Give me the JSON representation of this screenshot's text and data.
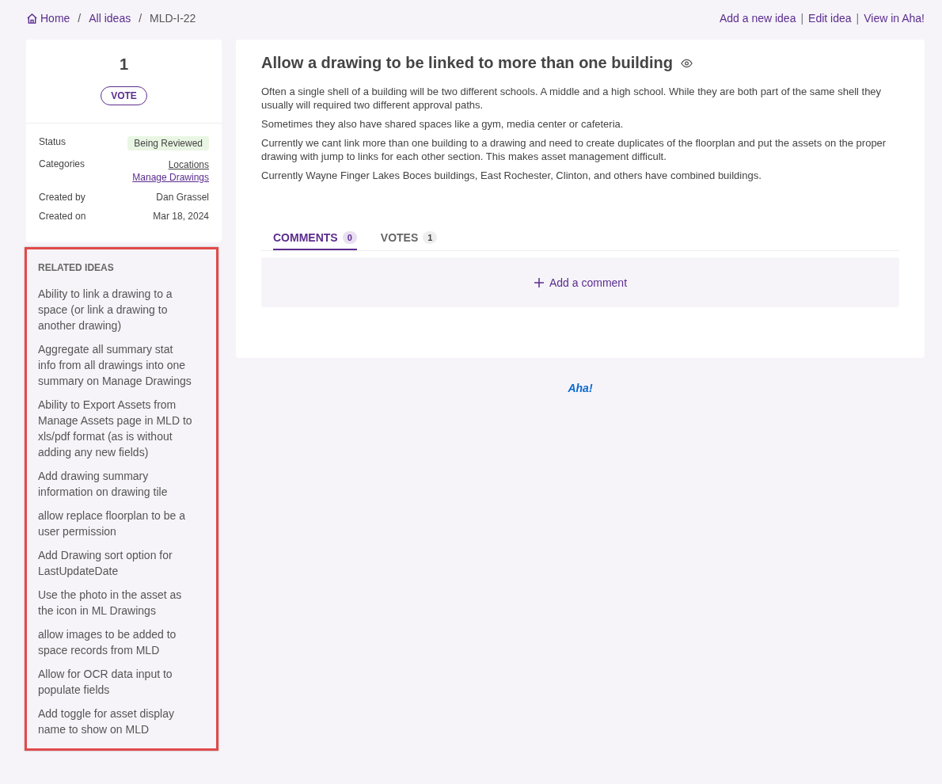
{
  "breadcrumb": [
    {
      "label": "Home",
      "kind": "home"
    },
    {
      "label": "All ideas",
      "kind": "link",
      "separator": "/"
    },
    {
      "label": "MLD-I-22",
      "kind": "current",
      "separator": "/"
    }
  ],
  "header_links": [
    {
      "label": "Add a new idea"
    },
    {
      "label": "Edit idea",
      "separator": "|"
    },
    {
      "label": "View in Aha!",
      "separator": "|"
    }
  ],
  "vote": {
    "count": "1",
    "button": "VOTE"
  },
  "details": [
    {
      "label": "Status",
      "kind": "badge",
      "values": [
        "Being Reviewed"
      ]
    },
    {
      "label": "Categories",
      "kind": "links",
      "values": [
        "Locations",
        "Manage Drawings"
      ]
    },
    {
      "label": "Created by",
      "kind": "text",
      "values": [
        "Dan Grassel"
      ]
    },
    {
      "label": "Created on",
      "kind": "text",
      "values": [
        "Mar 18, 2024"
      ]
    }
  ],
  "related_ideas": {
    "title": "RELATED IDEAS",
    "highlighted": true,
    "items": [
      "Ability to link a drawing to a space (or link a drawing to another drawing)",
      "Aggregate all summary stat info from all drawings into one summary on Manage Drawings",
      "Ability to Export Assets from Manage Assets page in MLD to xls/pdf format (as is without adding any new fields)",
      "Add drawing summary information on drawing tile",
      "allow replace floorplan to be a user permission",
      "Add Drawing sort option for LastUpdateDate",
      "Use the photo in the asset as the icon in ML Drawings",
      "allow images to be added to space records from MLD",
      "Allow for OCR data input to populate fields",
      "Add toggle for asset display name to show on MLD"
    ]
  },
  "idea": {
    "title": "Allow a drawing to be linked to more than one building",
    "paragraphs": [
      "Often a single shell of a building will be two different schools. A middle and a high school. While they are both part of the same shell they usually will required two different approval paths.",
      "Sometimes they also have shared spaces like a gym, media center or cafeteria.",
      "Currently we cant link more than one building to a drawing and need to create duplicates of the floorplan and put the assets on the proper drawing with jump to links for each other section. This makes asset management difficult.",
      "Currently Wayne Finger Lakes Boces buildings, East Rochester, Clinton, and others have combined buildings."
    ]
  },
  "tabs": [
    {
      "label": "COMMENTS",
      "count": "0",
      "selected": true
    },
    {
      "label": "VOTES",
      "count": "1",
      "selected": false
    }
  ],
  "add_comment": "Add a comment",
  "footer_logo": "Aha!"
}
